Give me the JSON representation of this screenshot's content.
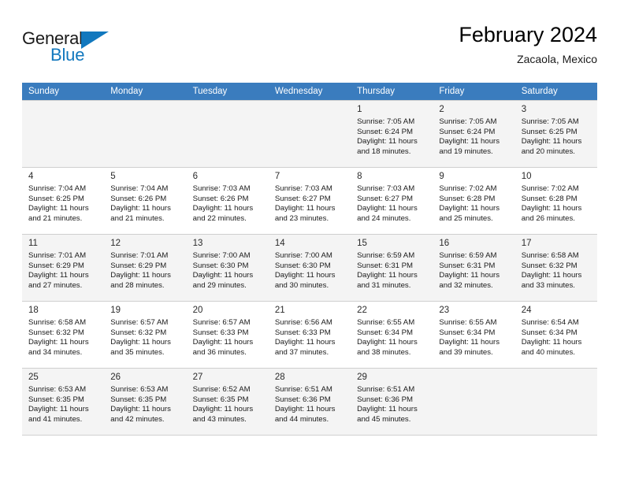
{
  "brand": {
    "name_top": "General",
    "name_bottom": "Blue",
    "accent_color": "#1278be"
  },
  "header": {
    "title": "February 2024",
    "subtitle": "Zacaola, Mexico"
  },
  "calendar": {
    "header_bg": "#3a7cbe",
    "weekdays": [
      "Sunday",
      "Monday",
      "Tuesday",
      "Wednesday",
      "Thursday",
      "Friday",
      "Saturday"
    ],
    "weeks": [
      [
        {
          "day": "",
          "sunrise": "",
          "sunset": "",
          "daylight1": "",
          "daylight2": ""
        },
        {
          "day": "",
          "sunrise": "",
          "sunset": "",
          "daylight1": "",
          "daylight2": ""
        },
        {
          "day": "",
          "sunrise": "",
          "sunset": "",
          "daylight1": "",
          "daylight2": ""
        },
        {
          "day": "",
          "sunrise": "",
          "sunset": "",
          "daylight1": "",
          "daylight2": ""
        },
        {
          "day": "1",
          "sunrise": "Sunrise: 7:05 AM",
          "sunset": "Sunset: 6:24 PM",
          "daylight1": "Daylight: 11 hours",
          "daylight2": "and 18 minutes."
        },
        {
          "day": "2",
          "sunrise": "Sunrise: 7:05 AM",
          "sunset": "Sunset: 6:24 PM",
          "daylight1": "Daylight: 11 hours",
          "daylight2": "and 19 minutes."
        },
        {
          "day": "3",
          "sunrise": "Sunrise: 7:05 AM",
          "sunset": "Sunset: 6:25 PM",
          "daylight1": "Daylight: 11 hours",
          "daylight2": "and 20 minutes."
        }
      ],
      [
        {
          "day": "4",
          "sunrise": "Sunrise: 7:04 AM",
          "sunset": "Sunset: 6:25 PM",
          "daylight1": "Daylight: 11 hours",
          "daylight2": "and 21 minutes."
        },
        {
          "day": "5",
          "sunrise": "Sunrise: 7:04 AM",
          "sunset": "Sunset: 6:26 PM",
          "daylight1": "Daylight: 11 hours",
          "daylight2": "and 21 minutes."
        },
        {
          "day": "6",
          "sunrise": "Sunrise: 7:03 AM",
          "sunset": "Sunset: 6:26 PM",
          "daylight1": "Daylight: 11 hours",
          "daylight2": "and 22 minutes."
        },
        {
          "day": "7",
          "sunrise": "Sunrise: 7:03 AM",
          "sunset": "Sunset: 6:27 PM",
          "daylight1": "Daylight: 11 hours",
          "daylight2": "and 23 minutes."
        },
        {
          "day": "8",
          "sunrise": "Sunrise: 7:03 AM",
          "sunset": "Sunset: 6:27 PM",
          "daylight1": "Daylight: 11 hours",
          "daylight2": "and 24 minutes."
        },
        {
          "day": "9",
          "sunrise": "Sunrise: 7:02 AM",
          "sunset": "Sunset: 6:28 PM",
          "daylight1": "Daylight: 11 hours",
          "daylight2": "and 25 minutes."
        },
        {
          "day": "10",
          "sunrise": "Sunrise: 7:02 AM",
          "sunset": "Sunset: 6:28 PM",
          "daylight1": "Daylight: 11 hours",
          "daylight2": "and 26 minutes."
        }
      ],
      [
        {
          "day": "11",
          "sunrise": "Sunrise: 7:01 AM",
          "sunset": "Sunset: 6:29 PM",
          "daylight1": "Daylight: 11 hours",
          "daylight2": "and 27 minutes."
        },
        {
          "day": "12",
          "sunrise": "Sunrise: 7:01 AM",
          "sunset": "Sunset: 6:29 PM",
          "daylight1": "Daylight: 11 hours",
          "daylight2": "and 28 minutes."
        },
        {
          "day": "13",
          "sunrise": "Sunrise: 7:00 AM",
          "sunset": "Sunset: 6:30 PM",
          "daylight1": "Daylight: 11 hours",
          "daylight2": "and 29 minutes."
        },
        {
          "day": "14",
          "sunrise": "Sunrise: 7:00 AM",
          "sunset": "Sunset: 6:30 PM",
          "daylight1": "Daylight: 11 hours",
          "daylight2": "and 30 minutes."
        },
        {
          "day": "15",
          "sunrise": "Sunrise: 6:59 AM",
          "sunset": "Sunset: 6:31 PM",
          "daylight1": "Daylight: 11 hours",
          "daylight2": "and 31 minutes."
        },
        {
          "day": "16",
          "sunrise": "Sunrise: 6:59 AM",
          "sunset": "Sunset: 6:31 PM",
          "daylight1": "Daylight: 11 hours",
          "daylight2": "and 32 minutes."
        },
        {
          "day": "17",
          "sunrise": "Sunrise: 6:58 AM",
          "sunset": "Sunset: 6:32 PM",
          "daylight1": "Daylight: 11 hours",
          "daylight2": "and 33 minutes."
        }
      ],
      [
        {
          "day": "18",
          "sunrise": "Sunrise: 6:58 AM",
          "sunset": "Sunset: 6:32 PM",
          "daylight1": "Daylight: 11 hours",
          "daylight2": "and 34 minutes."
        },
        {
          "day": "19",
          "sunrise": "Sunrise: 6:57 AM",
          "sunset": "Sunset: 6:32 PM",
          "daylight1": "Daylight: 11 hours",
          "daylight2": "and 35 minutes."
        },
        {
          "day": "20",
          "sunrise": "Sunrise: 6:57 AM",
          "sunset": "Sunset: 6:33 PM",
          "daylight1": "Daylight: 11 hours",
          "daylight2": "and 36 minutes."
        },
        {
          "day": "21",
          "sunrise": "Sunrise: 6:56 AM",
          "sunset": "Sunset: 6:33 PM",
          "daylight1": "Daylight: 11 hours",
          "daylight2": "and 37 minutes."
        },
        {
          "day": "22",
          "sunrise": "Sunrise: 6:55 AM",
          "sunset": "Sunset: 6:34 PM",
          "daylight1": "Daylight: 11 hours",
          "daylight2": "and 38 minutes."
        },
        {
          "day": "23",
          "sunrise": "Sunrise: 6:55 AM",
          "sunset": "Sunset: 6:34 PM",
          "daylight1": "Daylight: 11 hours",
          "daylight2": "and 39 minutes."
        },
        {
          "day": "24",
          "sunrise": "Sunrise: 6:54 AM",
          "sunset": "Sunset: 6:34 PM",
          "daylight1": "Daylight: 11 hours",
          "daylight2": "and 40 minutes."
        }
      ],
      [
        {
          "day": "25",
          "sunrise": "Sunrise: 6:53 AM",
          "sunset": "Sunset: 6:35 PM",
          "daylight1": "Daylight: 11 hours",
          "daylight2": "and 41 minutes."
        },
        {
          "day": "26",
          "sunrise": "Sunrise: 6:53 AM",
          "sunset": "Sunset: 6:35 PM",
          "daylight1": "Daylight: 11 hours",
          "daylight2": "and 42 minutes."
        },
        {
          "day": "27",
          "sunrise": "Sunrise: 6:52 AM",
          "sunset": "Sunset: 6:35 PM",
          "daylight1": "Daylight: 11 hours",
          "daylight2": "and 43 minutes."
        },
        {
          "day": "28",
          "sunrise": "Sunrise: 6:51 AM",
          "sunset": "Sunset: 6:36 PM",
          "daylight1": "Daylight: 11 hours",
          "daylight2": "and 44 minutes."
        },
        {
          "day": "29",
          "sunrise": "Sunrise: 6:51 AM",
          "sunset": "Sunset: 6:36 PM",
          "daylight1": "Daylight: 11 hours",
          "daylight2": "and 45 minutes."
        },
        {
          "day": "",
          "sunrise": "",
          "sunset": "",
          "daylight1": "",
          "daylight2": ""
        },
        {
          "day": "",
          "sunrise": "",
          "sunset": "",
          "daylight1": "",
          "daylight2": ""
        }
      ]
    ]
  }
}
